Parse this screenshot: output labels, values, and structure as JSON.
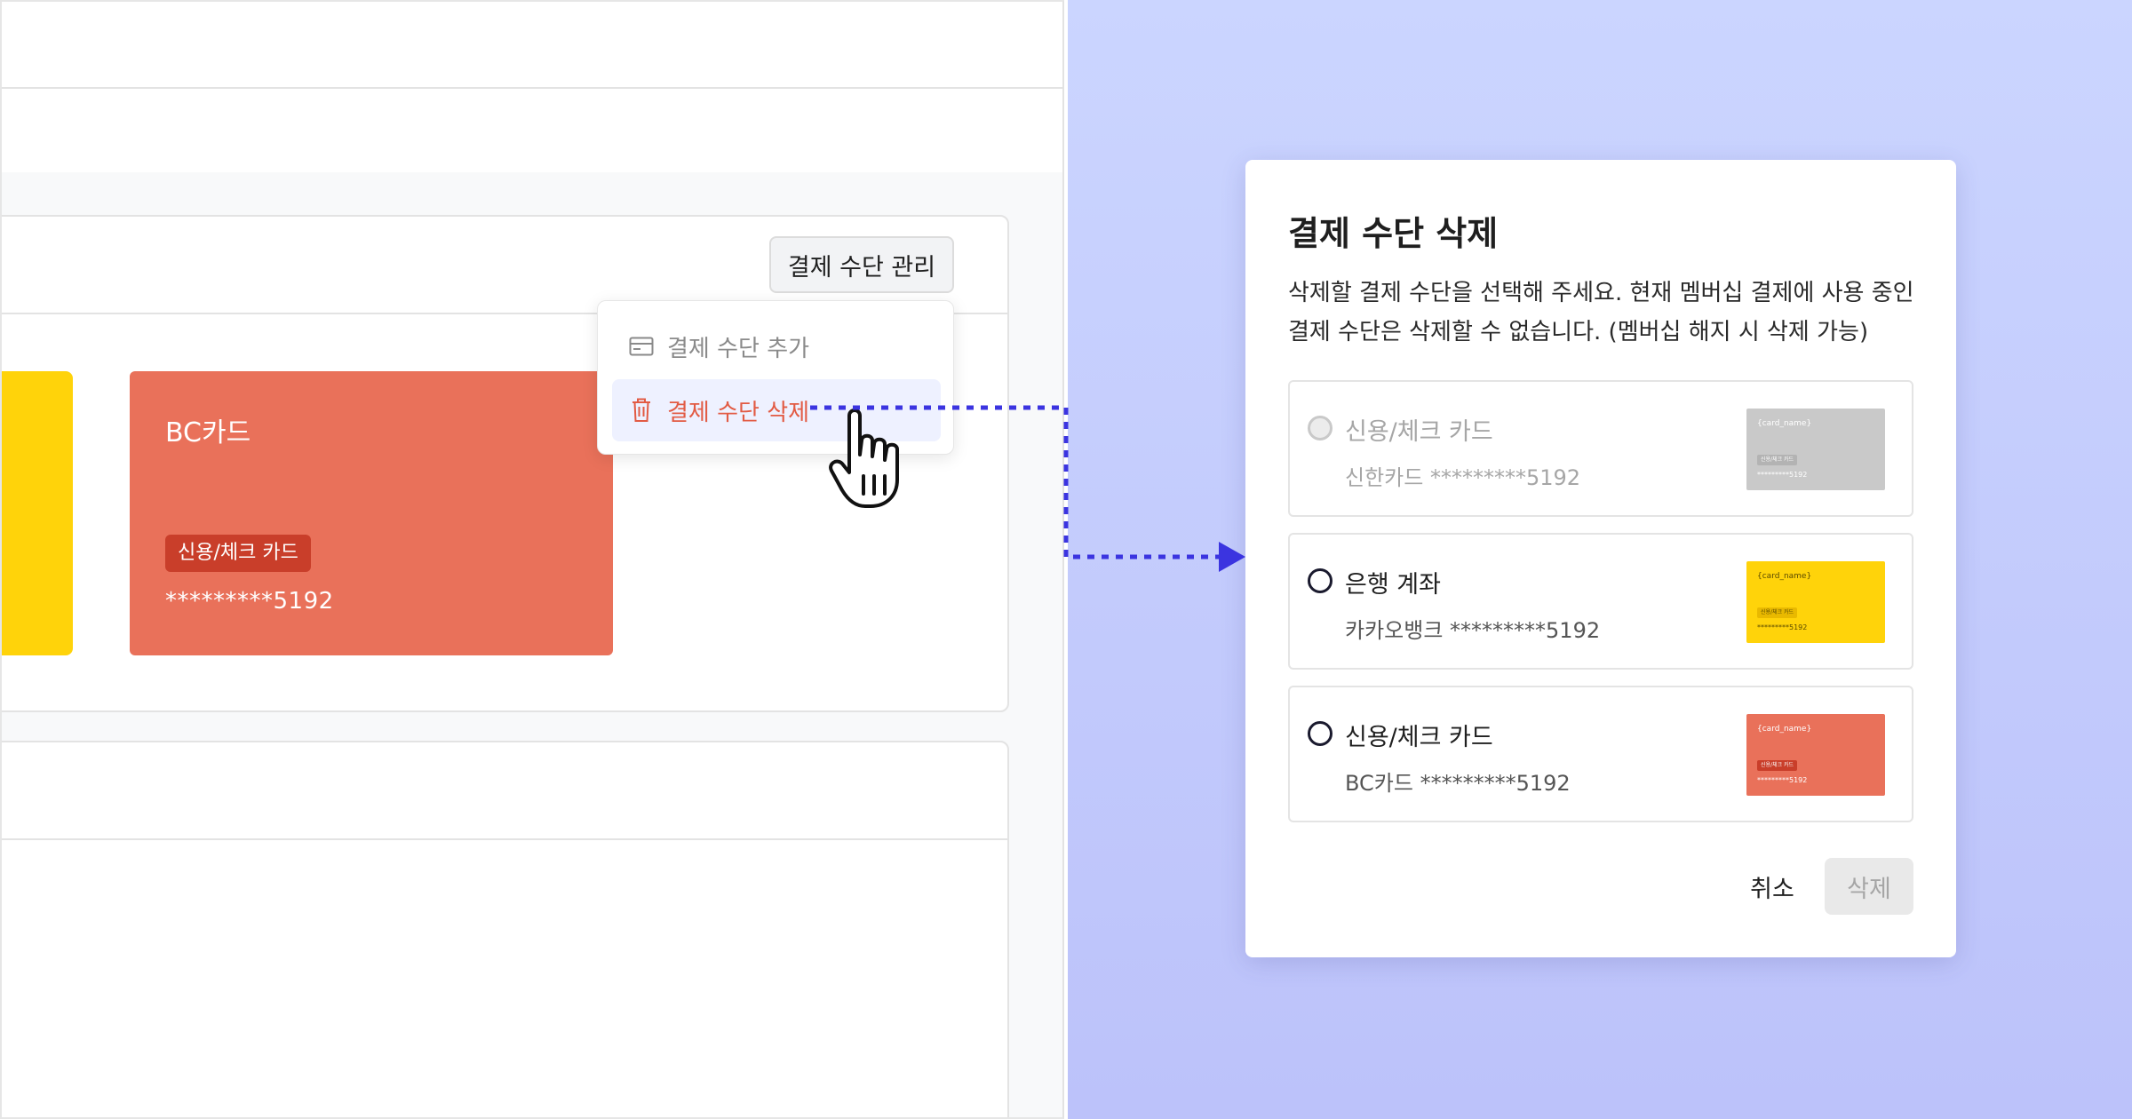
{
  "left": {
    "manage_button": "결제 수단 관리",
    "card": {
      "name": "BC카드",
      "badge": "신용/체크 카드",
      "number": "*********5192"
    },
    "dropdown": {
      "items": [
        {
          "label": "결제 수단 추가",
          "icon": "credit-card-icon"
        },
        {
          "label": "결제 수단 삭제",
          "icon": "trash-icon"
        }
      ]
    }
  },
  "dialog": {
    "title": "결제 수단 삭제",
    "description": "삭제할 결제 수단을 선택해 주세요. 현재 멤버십 결제에 사용 중인 결제 수단은 삭제할 수 없습니다. (멤버십 해지 시 삭제 가능)",
    "options": [
      {
        "title": "신용/체크 카드",
        "subtitle": "신한카드 *********5192",
        "disabled": true,
        "mini": {
          "name": "{card_name}",
          "badge": "신용/체크 카드",
          "number": "*********5192"
        }
      },
      {
        "title": "은행 계좌",
        "subtitle": "카카오뱅크 *********5192",
        "disabled": false,
        "mini": {
          "name": "{card_name}",
          "badge": "신용/체크 카드",
          "number": "*********5192"
        }
      },
      {
        "title": "신용/체크 카드",
        "subtitle": "BC카드 *********5192",
        "disabled": false,
        "mini": {
          "name": "{card_name}",
          "badge": "신용/체크 카드",
          "number": "*********5192"
        }
      }
    ],
    "cancel_label": "취소",
    "delete_label": "삭제"
  },
  "colors": {
    "accent_arrow": "#3b34e0",
    "card_red": "#e9715a",
    "card_yellow": "#ffd30a",
    "delete_text": "#e25b44",
    "right_bg": "#c5cdfd"
  }
}
